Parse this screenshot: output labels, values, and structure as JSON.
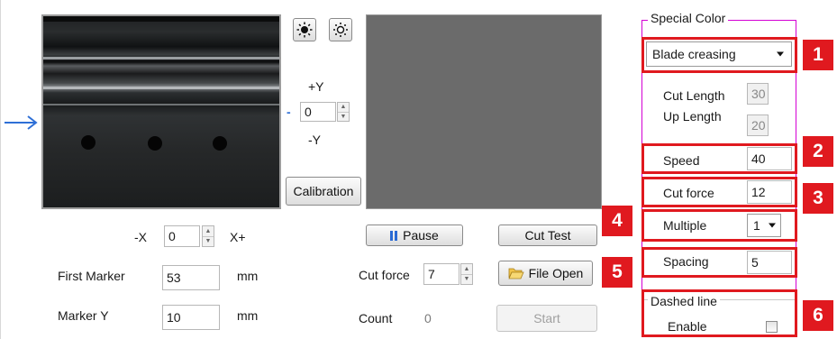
{
  "camera": {
    "brightness_up_icon": "sun-filled-icon",
    "brightness_down_icon": "sun-outline-icon"
  },
  "y_axis": {
    "plus_label": "+Y",
    "minus_label": "-Y",
    "value": "0",
    "dash": "-"
  },
  "x_axis": {
    "minus_label": "-X",
    "plus_label": "X+",
    "value": "0"
  },
  "calibration_label": "Calibration",
  "first_marker": {
    "label": "First Marker",
    "value": "53",
    "unit": "mm"
  },
  "marker_y": {
    "label": "Marker Y",
    "value": "10",
    "unit": "mm"
  },
  "pause_label": "Pause",
  "cut_test_label": "Cut Test",
  "file_open_label": "File Open",
  "start_label": "Start",
  "cut_force_main": {
    "label": "Cut force",
    "value": "7"
  },
  "count": {
    "label": "Count",
    "value": "0"
  },
  "special_color": {
    "title": "Special Color",
    "mode": "Blade creasing",
    "cut_length": {
      "label": "Cut Length",
      "value": "30"
    },
    "up_length": {
      "label": "Up Length",
      "value": "20"
    },
    "speed": {
      "label": "Speed",
      "value": "40"
    },
    "cut_force": {
      "label": "Cut force",
      "value": "12"
    },
    "multiple": {
      "label": "Multiple",
      "value": "1"
    },
    "spacing": {
      "label": "Spacing",
      "value": "5"
    }
  },
  "dashed_line": {
    "title": "Dashed line",
    "enable_label": "Enable",
    "enabled": false
  },
  "callouts": [
    "1",
    "2",
    "3",
    "4",
    "5",
    "6"
  ],
  "colors": {
    "callout_red": "#e0191f",
    "group_magenta": "#d400d4",
    "arrow_blue": "#2e6fd6"
  }
}
